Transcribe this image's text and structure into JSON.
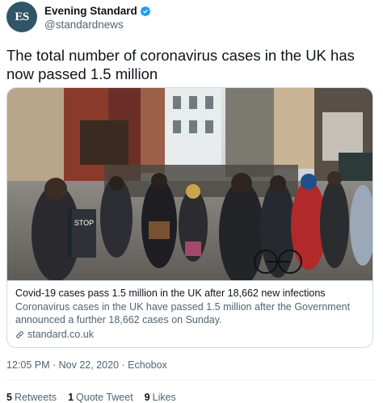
{
  "author": {
    "avatar_text": "ES",
    "display_name": "Evening Standard",
    "handle": "@standardnews",
    "verified": true
  },
  "tweet": {
    "text": "The total number of coronavirus cases in the UK has now passed 1.5 million"
  },
  "card": {
    "image_icon": "street-crowd-photo",
    "title": "Covid-19 cases pass 1.5 million in the UK after 18,662 new infections",
    "description": "Coronavirus cases in the UK have passed 1.5 million after the Government announced a further 18,662 cases on Sunday.",
    "domain": "standard.co.uk",
    "domain_icon": "link-icon"
  },
  "meta": {
    "time": "12:05 PM",
    "date": "Nov 22, 2020",
    "source": "Echobox",
    "separator": "·"
  },
  "stats": {
    "retweets_count": "5",
    "retweets_label": "Retweets",
    "quotes_count": "1",
    "quotes_label": "Quote Tweet",
    "likes_count": "9",
    "likes_label": "Likes"
  },
  "colors": {
    "verified_blue": "#1d9bf0",
    "avatar_bg": "#2f5566",
    "secondary_text": "#536471",
    "border": "#cfd9de"
  }
}
